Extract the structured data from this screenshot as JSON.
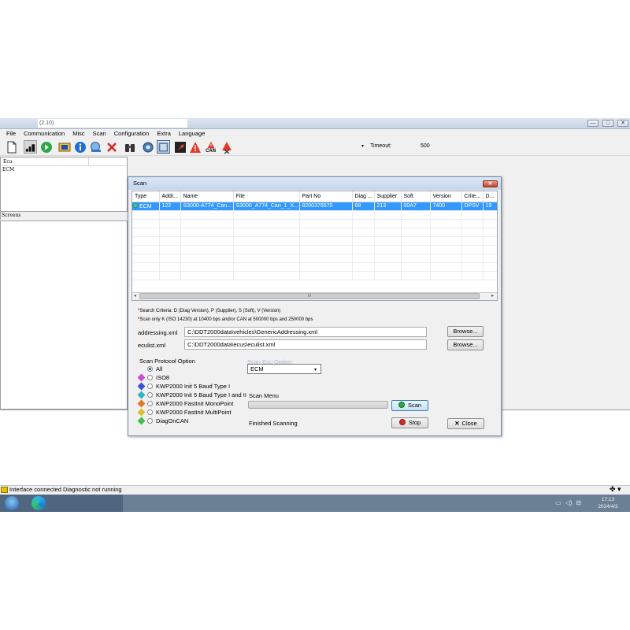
{
  "window": {
    "title": "(2.10)",
    "controls": {
      "minimize": "—",
      "maximize": "□",
      "close": "✕"
    }
  },
  "menu": [
    "File",
    "Communication",
    "Misc",
    "Scan",
    "Configuration",
    "Extra",
    "Language"
  ],
  "toolbar": {
    "icons": [
      "new-document-icon",
      "signal-bars-icon",
      "play-icon",
      "ecu-chip-icon",
      "info-icon",
      "scan-globe-icon",
      "delete-x-icon",
      "binoculars-icon",
      "settings-gear-icon",
      "frame-icon",
      "pin-icon",
      "warning-icon",
      "can-warning-icon",
      "clear-warning-icon"
    ],
    "can_text": "CAN",
    "timeout_label": "Timeout:",
    "timeout_value": "500",
    "dropdown_glyph": "▾"
  },
  "ecu_panel": {
    "header": "Ecu",
    "items": [
      "ECM"
    ]
  },
  "screens_panel": {
    "label": "Screens"
  },
  "status_bar": {
    "text": "Interface connected Diagnostic not running",
    "right": "✤ ▾"
  },
  "taskbar": {
    "time": "17:13",
    "date": "2024/4/3",
    "tray_icons": [
      "▭",
      "◁)",
      "⊟"
    ]
  },
  "scan_dialog": {
    "title": "Scan",
    "close_label": "✕",
    "columns": [
      "Type",
      "Addr...",
      "Name",
      "File",
      "Part No",
      "Diag ...",
      "Supplier",
      "Soft",
      "Version",
      "Crite...",
      "D..."
    ],
    "rows": [
      [
        "ECM",
        "122",
        "S3000-A774_Can...",
        "S3000_A774_Can_1_X...",
        "8200376570",
        "68",
        "213",
        "00A7",
        "7400",
        "DPSV",
        "19"
      ]
    ],
    "scroll_grip": "III",
    "scroll_left": "◂",
    "scroll_right": "▸",
    "note1": "*Search Criteria: D (Diag Version), P (Supplier), S (Soft), V (Version)",
    "note2": "*Scan only K (ISO 14230) at 10400 bps and/or CAN at 500000 bps and 250000 bps",
    "addressing_label": "addressing.xml",
    "addressing_value": "C:\\DDT2000data\\vehicles\\GenericAddressing.xml",
    "eculist_label": "eculist.xml",
    "eculist_value": "C:\\DDT2000data\\ecus\\eculist.xml",
    "browse_label": "Browse...",
    "protocol_title": "Scan Protocol Option",
    "protocols": [
      {
        "label": "All",
        "selected": true,
        "color": ""
      },
      {
        "label": "ISO8",
        "selected": false,
        "color": "#d04ad6"
      },
      {
        "label": "KWP2000 Init 5 Baud Type I",
        "selected": false,
        "color": "#3a4fd8"
      },
      {
        "label": "KWP2000 Init 5 Baud Type I and II",
        "selected": false,
        "color": "#2fb5c4"
      },
      {
        "label": "KWP2000 FastInit MonoPoint",
        "selected": false,
        "color": "#e07a2a"
      },
      {
        "label": "KWP2000 FastInit MultiPoint",
        "selected": false,
        "color": "#d8c22a"
      },
      {
        "label": "DiagOnCAN",
        "selected": false,
        "color": "#3fc24a"
      }
    ],
    "ecu_option_label": "Scan Ecu Option:",
    "ecu_option_value": "ECM",
    "scan_menu_label": "Scan Menu",
    "scan_button": "Scan",
    "stop_button": "Stop",
    "close_button": "Close",
    "status": "Finished Scanning",
    "progress_fraction": 0
  },
  "colors": {
    "selection": "#3399ff",
    "taskbar": "#6b7f95",
    "dialog_title": "#c5d7ec"
  }
}
